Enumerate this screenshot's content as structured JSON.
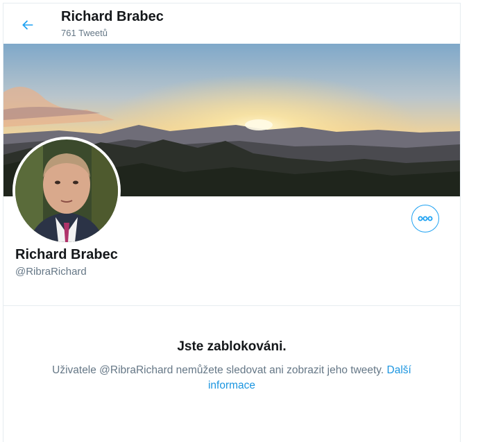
{
  "header": {
    "title": "Richard Brabec",
    "tweet_count": "761 Tweetů"
  },
  "profile": {
    "name": "Richard Brabec",
    "handle": "@RibraRichard"
  },
  "blocked": {
    "title": "Jste zablokováni.",
    "message": "Uživatele @RibraRichard nemůžete sledovat ani zobrazit jeho tweety.",
    "link": "Další informace"
  },
  "colors": {
    "accent": "#1da1f2",
    "secondary_text": "#657786",
    "border": "#e6ecf0"
  },
  "icons": {
    "back": "arrow-left-icon",
    "more": "more-horizontal-icon"
  }
}
